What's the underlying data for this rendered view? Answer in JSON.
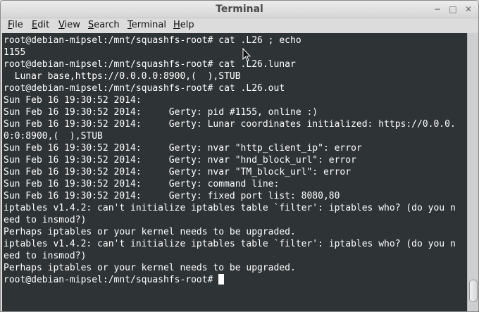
{
  "window": {
    "title": "Terminal",
    "controls": {
      "minimize": "−",
      "maximize": "□",
      "close": "✕"
    }
  },
  "menubar": {
    "items": [
      {
        "accel": "F",
        "rest": "ile"
      },
      {
        "accel": "E",
        "rest": "dit"
      },
      {
        "accel": "V",
        "rest": "iew"
      },
      {
        "accel": "S",
        "rest": "earch"
      },
      {
        "accel": "T",
        "rest": "erminal"
      },
      {
        "accel": "H",
        "rest": "elp"
      }
    ]
  },
  "terminal": {
    "lines": [
      "root@debian-mipsel:/mnt/squashfs-root# cat .L26 ; echo",
      "1155",
      "root@debian-mipsel:/mnt/squashfs-root# cat .L26.lunar",
      "  Lunar base,https://0.0.0.0:8900,(  ),STUB",
      "root@debian-mipsel:/mnt/squashfs-root# cat .L26.out",
      "Sun Feb 16 19:30:52 2014:",
      "Sun Feb 16 19:30:52 2014:     Gerty: pid #1155, online :)",
      "Sun Feb 16 19:30:52 2014:     Gerty: Lunar coordinates initialized: https://0.0.0.",
      "0:0:8900,(  ),STUB",
      "Sun Feb 16 19:30:52 2014:     Gerty: nvar \"http_client_ip\": error",
      "Sun Feb 16 19:30:52 2014:     Gerty: nvar \"hnd_block_url\": error",
      "Sun Feb 16 19:30:52 2014:     Gerty: nvar \"TM_block_url\": error",
      "Sun Feb 16 19:30:52 2014:     Gerty: command line:",
      "Sun Feb 16 19:30:52 2014:     Gerty: fixed port list: 8080,80",
      "iptables v1.4.2: can't initialize iptables table `filter': iptables who? (do you n",
      "eed to insmod?)",
      "Perhaps iptables or your kernel needs to be upgraded.",
      "iptables v1.4.2: can't initialize iptables table `filter': iptables who? (do you n",
      "eed to insmod?)",
      "Perhaps iptables or your kernel needs to be upgraded."
    ],
    "prompt": "root@debian-mipsel:/mnt/squashfs-root# ",
    "background": "#2e3436",
    "foreground": "#ffffff"
  },
  "icons": {
    "cursor": "text-cursor-block",
    "pointer": "mouse-pointer-arrow"
  }
}
